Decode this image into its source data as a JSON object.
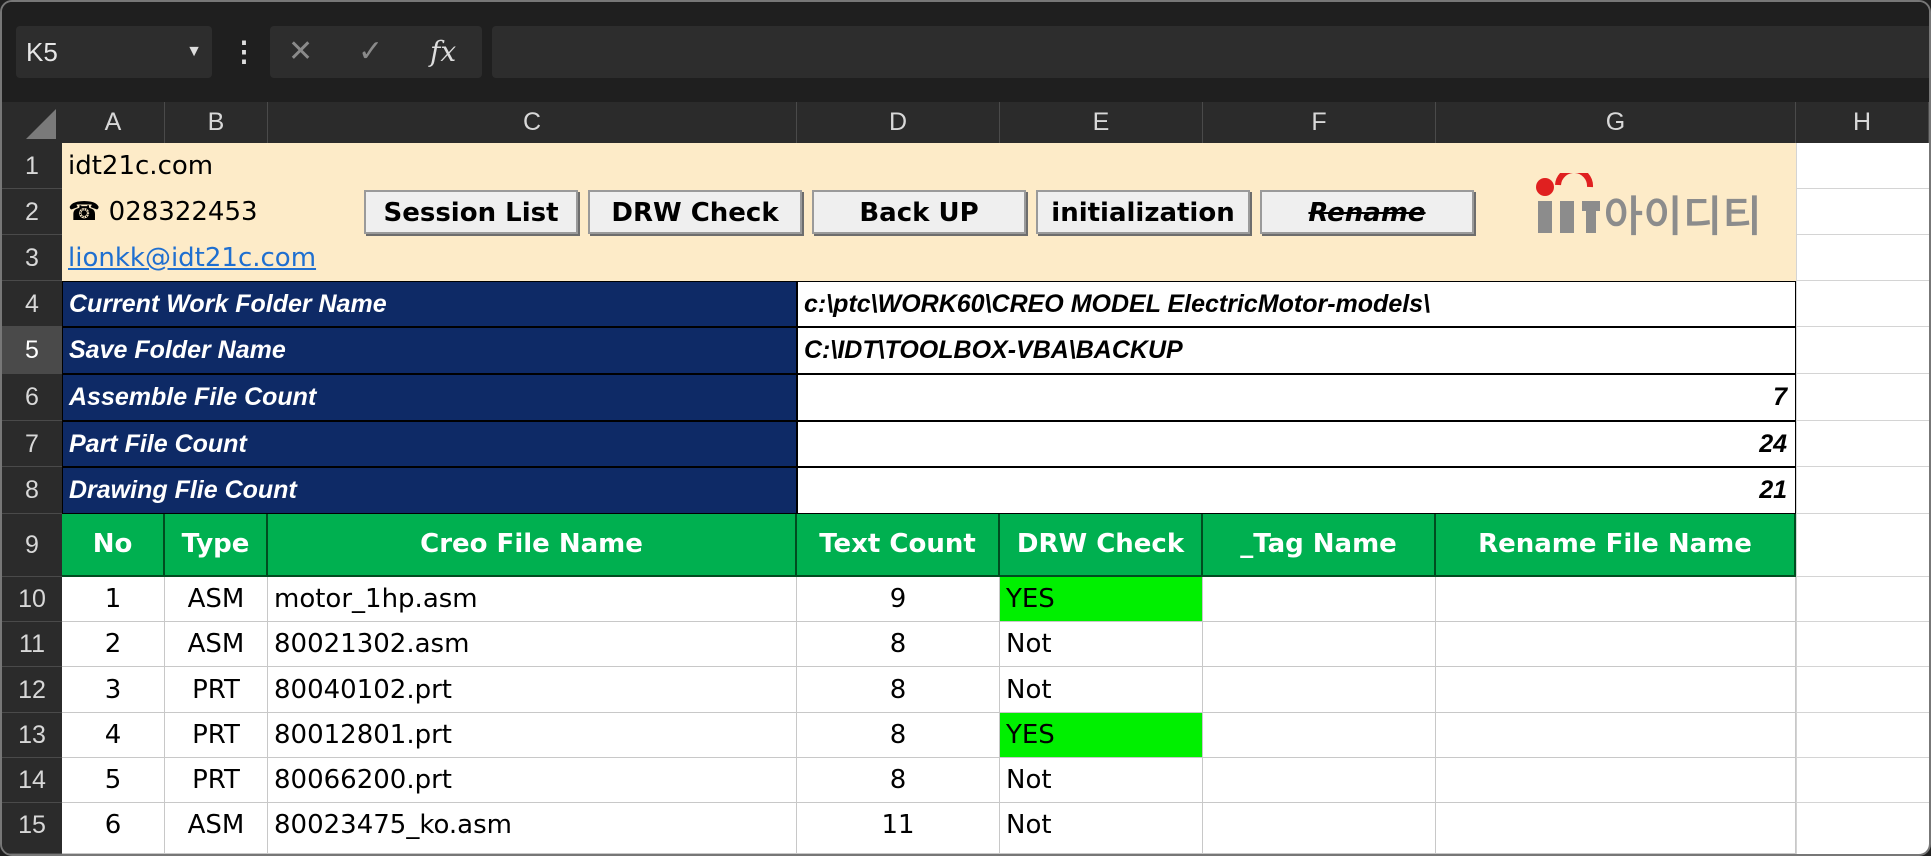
{
  "formula_bar": {
    "name_box": "K5",
    "cancel_icon": "✕",
    "enter_icon": "✓",
    "fx_label": "fx",
    "formula": ""
  },
  "columns": [
    "A",
    "B",
    "C",
    "D",
    "E",
    "F",
    "G",
    "H"
  ],
  "rows": [
    "1",
    "2",
    "3",
    "4",
    "5",
    "6",
    "7",
    "8",
    "9",
    "10",
    "11",
    "12",
    "13",
    "14",
    "15"
  ],
  "selected_row": "5",
  "header": {
    "site": "idt21c.com",
    "phone_icon": "☎",
    "phone": "028322453",
    "email": "lionkk@idt21c.com",
    "logo_text": "아이디티"
  },
  "buttons": {
    "session_list": "Session List",
    "drw_check": "DRW Check",
    "back_up": "Back UP",
    "initialization": "initialization",
    "rename": "Rename"
  },
  "info": {
    "work_folder_label": "Current Work Folder Name",
    "work_folder_value": "c:\\ptc\\WORK60\\CREO MODEL ElectricMotor-models\\",
    "save_folder_label": "Save Folder  Name",
    "save_folder_value": "C:\\IDT\\TOOLBOX-VBA\\BACKUP",
    "asm_count_label": "Assemble File Count",
    "asm_count_value": "7",
    "part_count_label": "Part File Count",
    "part_count_value": "24",
    "drw_count_label": "Drawing Flie Count",
    "drw_count_value": "21"
  },
  "table": {
    "headers": [
      "No",
      "Type",
      "Creo File Name",
      "Text Count",
      "DRW Check",
      "_Tag Name",
      "Rename File Name"
    ],
    "rows": [
      {
        "no": "1",
        "type": "ASM",
        "name": "motor_1hp.asm",
        "count": "9",
        "drw": "YES",
        "tag": "",
        "rename": ""
      },
      {
        "no": "2",
        "type": "ASM",
        "name": "80021302.asm",
        "count": "8",
        "drw": "Not",
        "tag": "",
        "rename": ""
      },
      {
        "no": "3",
        "type": "PRT",
        "name": "80040102.prt",
        "count": "8",
        "drw": "Not",
        "tag": "",
        "rename": ""
      },
      {
        "no": "4",
        "type": "PRT",
        "name": "80012801.prt",
        "count": "8",
        "drw": "YES",
        "tag": "",
        "rename": ""
      },
      {
        "no": "5",
        "type": "PRT",
        "name": "80066200.prt",
        "count": "8",
        "drw": "Not",
        "tag": "",
        "rename": ""
      },
      {
        "no": "6",
        "type": "ASM",
        "name": "80023475_ko.asm",
        "count": "11",
        "drw": "Not",
        "tag": "",
        "rename": ""
      }
    ]
  },
  "colors": {
    "navy": "#0e2a66",
    "green_header": "#00b050",
    "yes_green": "#00f000",
    "beige": "#fdebc8"
  }
}
